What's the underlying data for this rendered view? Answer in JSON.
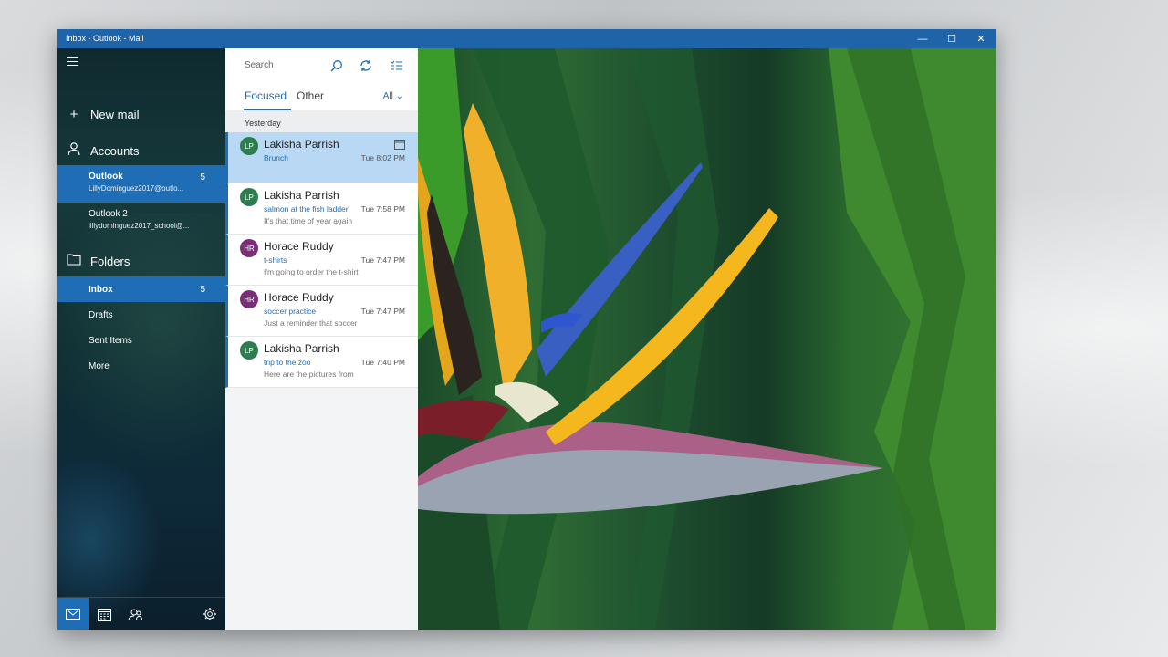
{
  "window": {
    "title": "Inbox - Outlook - Mail",
    "minimize_glyph": "—",
    "maximize_glyph": "☐",
    "close_glyph": "✕"
  },
  "nav": {
    "menu_icon": "hamburger-icon",
    "new_mail": "New mail",
    "accounts_label": "Accounts",
    "accounts": [
      {
        "name": "Outlook",
        "email": "LillyDominguez2017@outlo...",
        "count": "5"
      },
      {
        "name": "Outlook 2",
        "email": "lillydominguez2017_school@..."
      }
    ],
    "folders_label": "Folders",
    "folders": [
      {
        "name": "Inbox",
        "count": "5"
      },
      {
        "name": "Drafts"
      },
      {
        "name": "Sent Items"
      },
      {
        "name": "More"
      }
    ]
  },
  "list": {
    "search_placeholder": "Search",
    "tabs": [
      "Focused",
      "Other"
    ],
    "filter": "All",
    "group": "Yesterday",
    "messages": [
      {
        "initials": "LP",
        "sender": "Lakisha Parrish",
        "subject": "Brunch",
        "preview": "",
        "time": "Tue 8:02 PM",
        "avatar_color": "#2e7d4f"
      },
      {
        "initials": "LP",
        "sender": "Lakisha Parrish",
        "subject": "salmon at the fish ladder",
        "preview": "It's that time of year again",
        "time": "Tue 7:58 PM",
        "avatar_color": "#2e7d4f"
      },
      {
        "initials": "HR",
        "sender": "Horace Ruddy",
        "subject": "t-shirts",
        "preview": "I'm going to order the t-shirts",
        "time": "Tue 7:47 PM",
        "avatar_color": "#7a2e7a"
      },
      {
        "initials": "HR",
        "sender": "Horace Ruddy",
        "subject": "soccer practice",
        "preview": "Just a reminder that soccer",
        "time": "Tue 7:47 PM",
        "avatar_color": "#7a2e7a"
      },
      {
        "initials": "LP",
        "sender": "Lakisha Parrish",
        "subject": "trip to the zoo",
        "preview": "Here are the pictures from",
        "time": "Tue 7:40 PM",
        "avatar_color": "#2e7d4f"
      }
    ]
  },
  "colors": {
    "accent": "#1f6eb5",
    "titlebar": "#1f63a8",
    "selected_message": "#b9d8f4"
  }
}
